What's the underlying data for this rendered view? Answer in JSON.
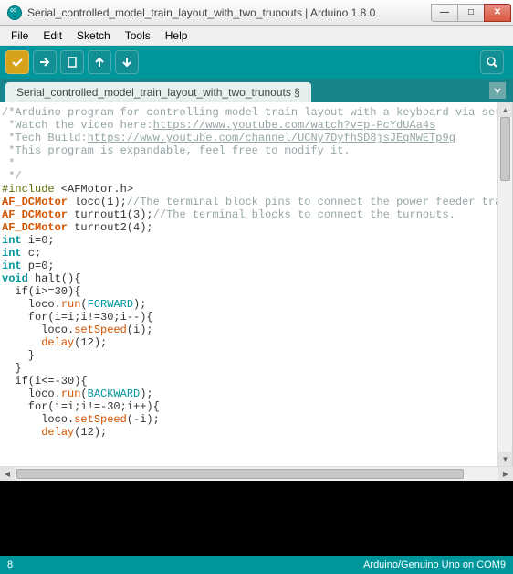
{
  "window": {
    "title": "Serial_controlled_model_train_layout_with_two_trunouts | Arduino 1.8.0"
  },
  "menu": {
    "file": "File",
    "edit": "Edit",
    "sketch": "Sketch",
    "tools": "Tools",
    "help": "Help"
  },
  "tabs": {
    "main": "Serial_controlled_model_train_layout_with_two_trunouts §"
  },
  "code": {
    "l1a": "/*Arduino program for controlling model train layout with a keyboard via serial communicatic",
    "l2a": " *Watch the video here:",
    "l2b": "https://www.youtube.com/watch?v=p-PcYdUAa4s",
    "l3a": " *Tech Build:",
    "l3b": "https://www.youtube.com/channel/UCNy7DyfhSD8jsJEqNWETp9g",
    "l4": " *This program is expandable, feel free to modify it.",
    "l5": " *",
    "l6": " */",
    "l7a": "#include",
    "l7b": " <AFMotor.h>",
    "l8a": "AF_DCMotor",
    "l8b": " loco(1);",
    "l8c": "//The terminal block pins to connect the power feeder track.",
    "l9a": "AF_DCMotor",
    "l9b": " turnout1(3);",
    "l9c": "//The terminal blocks to connect the turnouts.",
    "l10a": "AF_DCMotor",
    "l10b": " turnout2(4);",
    "l11a": "int",
    "l11b": " i=0;",
    "l12a": "int",
    "l12b": " c;",
    "l13a": "int",
    "l13b": " p=0;",
    "l14a": "void",
    "l14b": " halt(){",
    "l15": "  if(i>=30){",
    "l16a": "    loco.",
    "l16b": "run",
    "l16c": "(",
    "l16d": "FORWARD",
    "l16e": ");",
    "l17": "    for(i=i;i!=30;i--){",
    "l18a": "      loco.",
    "l18b": "setSpeed",
    "l18c": "(i);",
    "l19a": "      ",
    "l19b": "delay",
    "l19c": "(12);",
    "l20": "    }",
    "l21": "  }",
    "l22": "  if(i<=-30){",
    "l23a": "    loco.",
    "l23b": "run",
    "l23c": "(",
    "l23d": "BACKWARD",
    "l23e": ");",
    "l24": "    for(i=i;i!=-30;i++){",
    "l25a": "      loco.",
    "l25b": "setSpeed",
    "l25c": "(-i);",
    "l26a": "      ",
    "l26b": "delay",
    "l26c": "(12);"
  },
  "status": {
    "line": "8",
    "board": "Arduino/Genuino Uno on COM9"
  }
}
